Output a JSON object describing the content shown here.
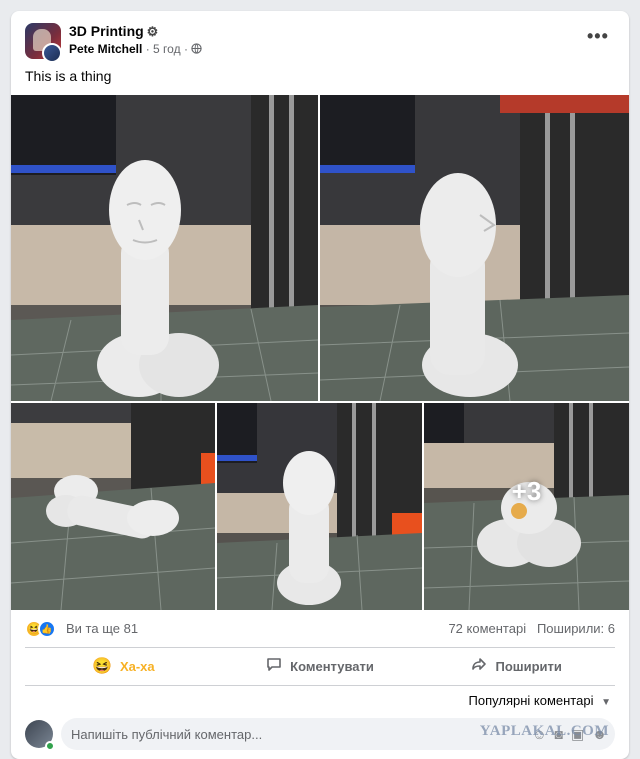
{
  "post": {
    "group_name": "3D Printing",
    "group_badge": "⚙",
    "author": "Pete Mitchell",
    "time": "5 год",
    "separator": "·",
    "privacy_icon": "globe-icon",
    "text": "This is a thing",
    "more_icon": "•••"
  },
  "gallery": {
    "more_count": "+3"
  },
  "stats": {
    "reactions": "Ви та ще 81",
    "comments": "72 коментарі",
    "shares": "Поширили: 6"
  },
  "actions": {
    "reaction": "Ха-ха",
    "comment": "Коментувати",
    "share": "Поширити"
  },
  "comments": {
    "sort": "Популярні коментарі",
    "placeholder": "Напишіть публічний коментар..."
  },
  "watermark": "YAPLAKAL.COM",
  "colors": {
    "haha": "#f7b125",
    "like": "#1877f2",
    "online": "#31a24c"
  }
}
